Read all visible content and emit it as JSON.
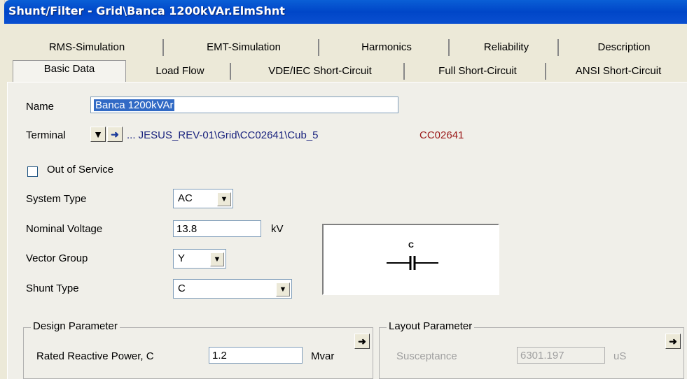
{
  "window": {
    "title": "Shunt/Filter - Grid\\Banca 1200kVAr.ElmShnt"
  },
  "tabs_row1": [
    "RMS-Simulation",
    "EMT-Simulation",
    "Harmonics",
    "Reliability",
    "Description"
  ],
  "tabs_row2": [
    "Basic Data",
    "Load Flow",
    "VDE/IEC Short-Circuit",
    "Full Short-Circuit",
    "ANSI Short-Circuit"
  ],
  "form": {
    "name_label": "Name",
    "name_value": "Banca 1200kVAr",
    "terminal_label": "Terminal",
    "terminal_path": "... JESUS_REV-01\\Grid\\CC02641\\Cub_5",
    "terminal_node": "CC02641",
    "out_of_service_label": "Out of Service",
    "system_type_label": "System Type",
    "system_type_value": "AC",
    "nominal_voltage_label": "Nominal Voltage",
    "nominal_voltage_value": "13.8",
    "nominal_voltage_unit": "kV",
    "vector_group_label": "Vector Group",
    "vector_group_value": "Y",
    "shunt_type_label": "Shunt Type",
    "shunt_type_value": "C",
    "symbol_label": "C"
  },
  "design": {
    "title": "Design Parameter",
    "rated_label": "Rated Reactive Power, C",
    "rated_value": "1.2",
    "rated_unit": "Mvar"
  },
  "layout": {
    "title": "Layout Parameter",
    "susceptance_label": "Susceptance",
    "susceptance_value": "6301.197",
    "susceptance_unit": "uS"
  },
  "colors": {
    "link_blue": "#1a237e",
    "node_red": "#9b1b1b",
    "selection": "#316ac5"
  }
}
